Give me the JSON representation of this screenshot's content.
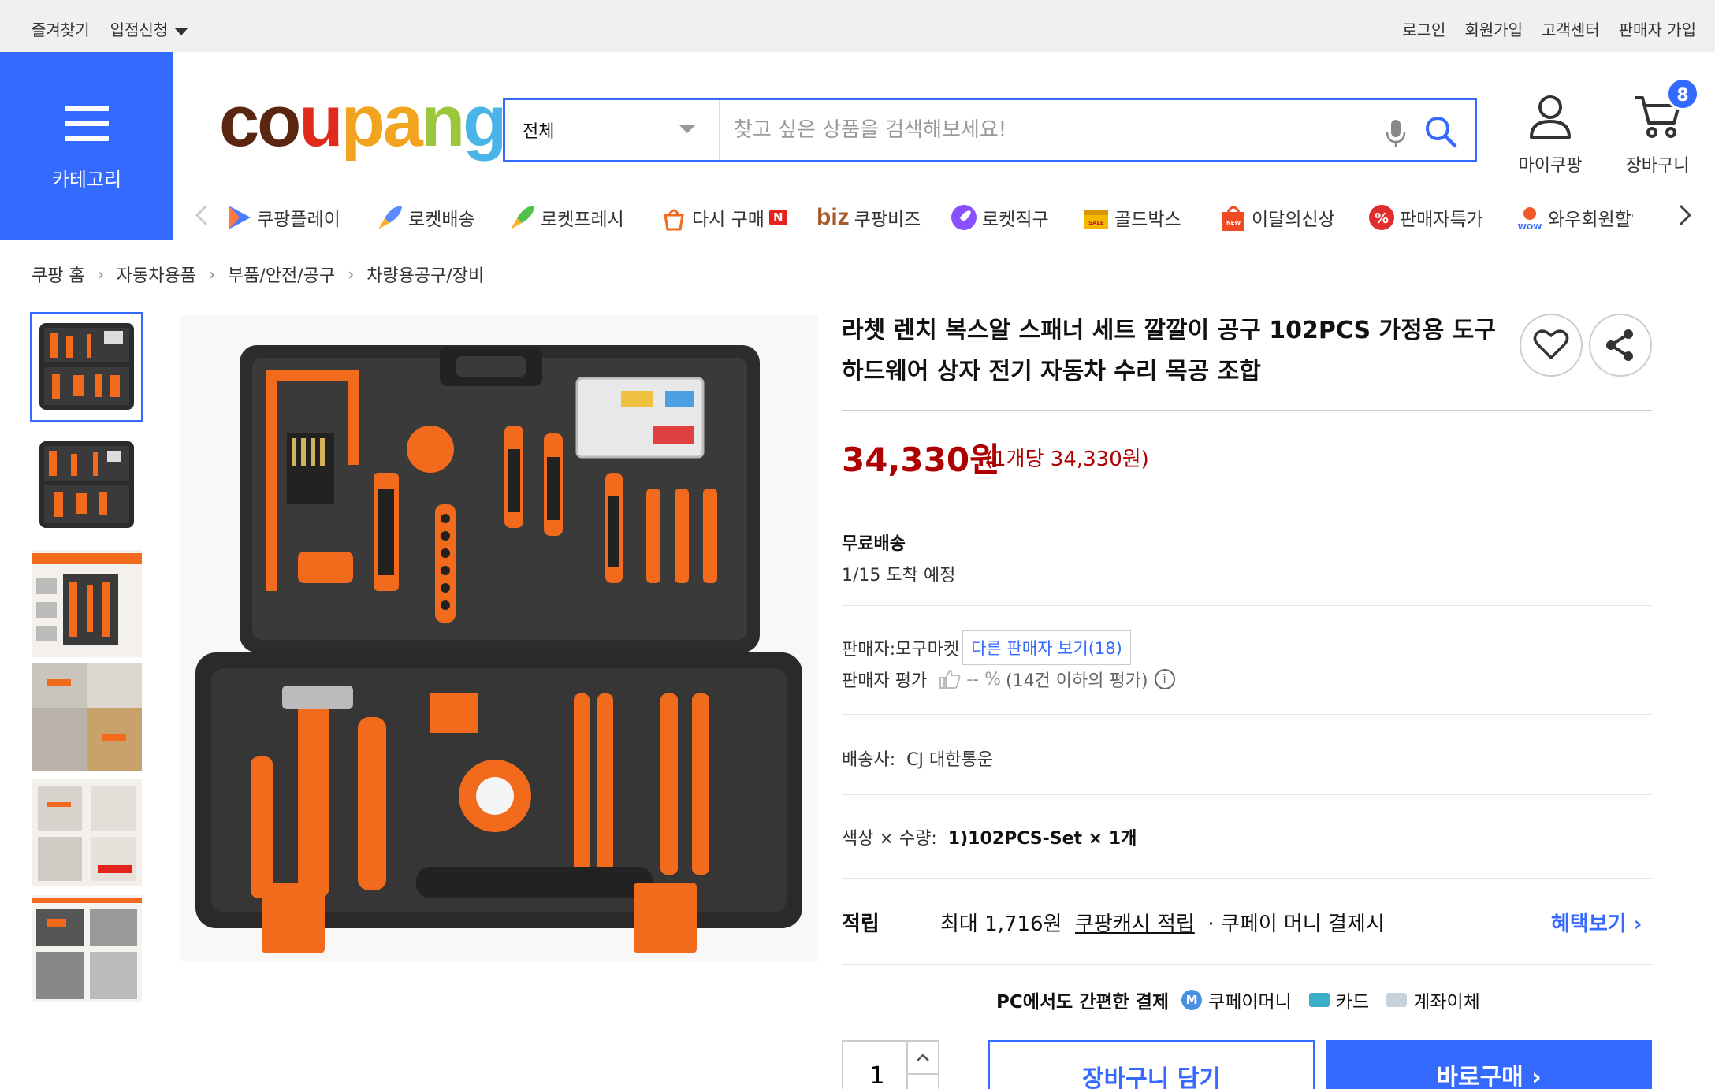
{
  "topbar": {
    "favorites": "즐겨찾기",
    "vendor_apply": "입점신청",
    "login": "로그인",
    "signup": "회원가입",
    "customer_center": "고객센터",
    "seller_signup": "판매자 가입"
  },
  "header": {
    "category_label": "카테고리",
    "logo": "coupang",
    "search_scope": "전체",
    "search_placeholder": "찾고 싶은 상품을 검색해보세요!",
    "my_coupang": "마이쿠팡",
    "cart": "장바구니",
    "cart_count": "8",
    "brand_color": "#346aff"
  },
  "catnav": [
    {
      "label": "쿠팡플레이",
      "icon": "play-icon"
    },
    {
      "label": "로켓배송",
      "icon": "rocket-icon"
    },
    {
      "label": "로켓프레시",
      "icon": "rocket-fresh-icon"
    },
    {
      "label": "다시 구매",
      "icon": "rebuy-icon",
      "badge": "N"
    },
    {
      "label": "쿠팡비즈",
      "prefix": "biz",
      "icon": "biz-icon"
    },
    {
      "label": "로켓직구",
      "icon": "global-rocket-icon"
    },
    {
      "label": "골드박스",
      "icon": "goldbox-icon"
    },
    {
      "label": "이달의신상",
      "icon": "new-bag-icon"
    },
    {
      "label": "판매자특가",
      "icon": "percent-icon"
    },
    {
      "label": "와우회원할인",
      "icon": "wow-icon"
    }
  ],
  "breadcrumb": [
    "쿠팡 홈",
    "자동차용품",
    "부품/안전/공구",
    "차량용공구/장비"
  ],
  "product": {
    "title": "라쳇 렌치 복스알 스패너 세트 깔깔이 공구 102PCS 가정용 도구 하드웨어 상자 전기 자동차 수리 목공 조합",
    "price": "34,330원",
    "unit_price": "(1개당 34,330원)",
    "price_color": "#ae0000",
    "shipping_label": "무료배송",
    "arrival": "1/15 도착 예정",
    "seller_prefix": "판매자:",
    "seller_name": "모구마켓",
    "other_sellers": "다른 판매자 보기(18)",
    "rating_label": "판매자 평가",
    "rating_value": "-- %",
    "rating_note": "(14건 이하의 평가)",
    "carrier_label": "배송사:",
    "carrier": "CJ 대한통운",
    "option_label": "색상 × 수량:",
    "option_value": "1)102PCS-Set × 1개",
    "reward_label": "적립",
    "reward_max": "최대 1,716원",
    "reward_link": "쿠팡캐시 적립",
    "reward_cond": "· 쿠페이 머니 결제시",
    "benefit_link": "혜택보기",
    "pay_heading": "PC에서도 간편한 결제",
    "pay_options": [
      "쿠페이머니",
      "카드",
      "계좌이체"
    ],
    "quantity": "1",
    "add_cart": "장바구니 담기",
    "buy_now": "바로구매"
  }
}
